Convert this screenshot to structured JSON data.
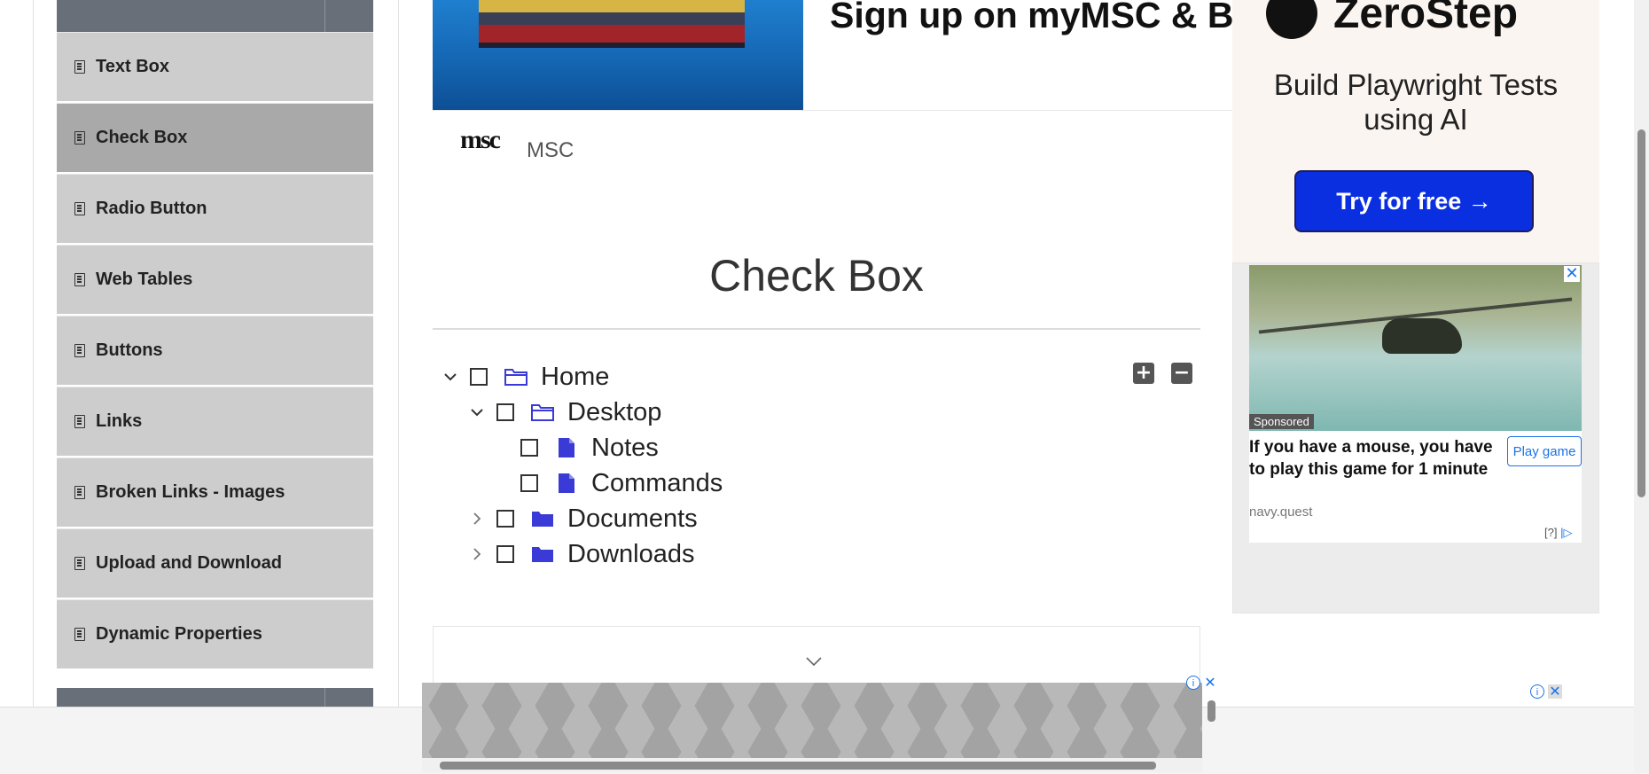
{
  "sidebar": {
    "items": [
      {
        "label": "Text Box",
        "active": false
      },
      {
        "label": "Check Box",
        "active": true
      },
      {
        "label": "Radio Button",
        "active": false
      },
      {
        "label": "Web Tables",
        "active": false
      },
      {
        "label": "Buttons",
        "active": false
      },
      {
        "label": "Links",
        "active": false
      },
      {
        "label": "Broken Links - Images",
        "active": false
      },
      {
        "label": "Upload and Download",
        "active": false
      },
      {
        "label": "Dynamic Properties",
        "active": false
      }
    ]
  },
  "top_ad": {
    "headline": "Sign up on myMSC & B",
    "advertiser_logo": "msc",
    "advertiser": "MSC"
  },
  "main": {
    "title": "Check Box",
    "tree": {
      "expand_all_icon": "plus-square-icon",
      "collapse_all_icon": "minus-square-icon",
      "nodes": [
        {
          "label": "Home",
          "type": "folder-open",
          "expanded": true,
          "checked": false
        },
        {
          "label": "Desktop",
          "type": "folder-open",
          "expanded": true,
          "checked": false
        },
        {
          "label": "Notes",
          "type": "file",
          "checked": false
        },
        {
          "label": "Commands",
          "type": "file",
          "checked": false
        },
        {
          "label": "Documents",
          "type": "folder",
          "expanded": false,
          "checked": false
        },
        {
          "label": "Downloads",
          "type": "folder",
          "expanded": false,
          "checked": false
        }
      ]
    }
  },
  "right_ads": {
    "zerostep": {
      "brand": "ZeroStep",
      "tagline": "Build Playwright Tests using AI",
      "cta": "Try for free →"
    },
    "game": {
      "sponsored": "Sponsored",
      "headline": "If you have a mouse, you have to play this game for 1 minute",
      "cta": "Play game",
      "source": "navy.quest",
      "adchoices": "[?]"
    }
  },
  "colors": {
    "sidebar_item": "#cdcdcd",
    "sidebar_active": "#a9a9a9",
    "sidebar_header": "#696f78",
    "tree_icon": "#3a3ad6",
    "cta_blue": "#0a2fe0"
  }
}
